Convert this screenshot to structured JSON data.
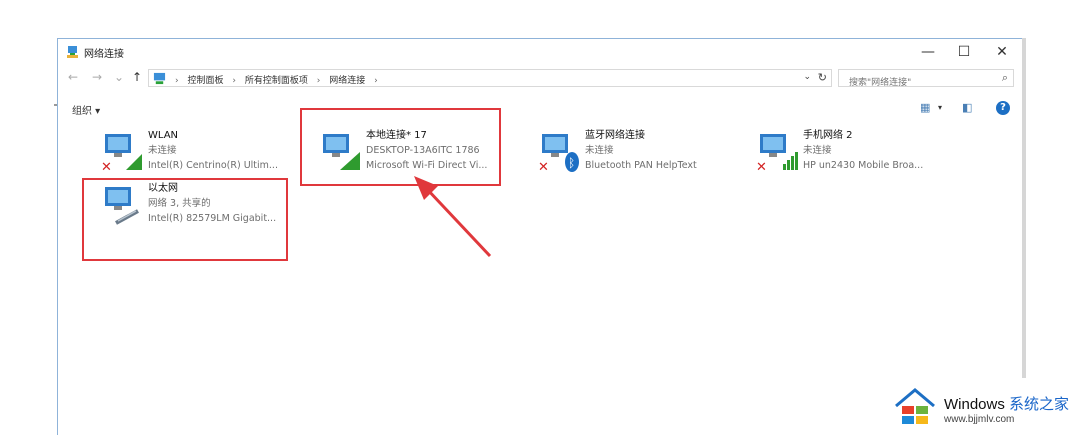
{
  "window": {
    "title": "网络连接",
    "buttons": {
      "minimize": "—",
      "maximize": "☐",
      "close": "✕"
    }
  },
  "nav": {
    "back": "←",
    "forward": "→",
    "recent": "⌄",
    "up": "↑",
    "breadcrumb": [
      "控制面板",
      "所有控制面板项",
      "网络连接"
    ],
    "separator": "›",
    "search_placeholder": "搜索\"网络连接\""
  },
  "commandbar": {
    "organize": "组织 ▾"
  },
  "connections": [
    {
      "name": "WLAN",
      "status": "未连接",
      "adapter": "Intel(R) Centrino(R) Ultim...",
      "icon": "wifi-adapter-icon",
      "state": "disconnected"
    },
    {
      "name": "本地连接* 17",
      "status": "DESKTOP-13A6ITC 1786",
      "adapter": "Microsoft Wi-Fi Direct Vi...",
      "icon": "wifi-adapter-icon",
      "state": "connected"
    },
    {
      "name": "蓝牙网络连接",
      "status": "未连接",
      "adapter": "Bluetooth PAN HelpText",
      "icon": "bluetooth-adapter-icon",
      "state": "disconnected"
    },
    {
      "name": "手机网络 2",
      "status": "未连接",
      "adapter": "HP un2430 Mobile Broa...",
      "icon": "mobile-broadband-icon",
      "state": "disconnected"
    },
    {
      "name": "以太网",
      "status": "网络 3, 共享的",
      "adapter": "Intel(R) 82579LM Gigabit...",
      "icon": "ethernet-adapter-icon",
      "state": "connected"
    }
  ],
  "watermark": {
    "brand": "Windows",
    "brand_cn": "系统之家",
    "url": "www.bjjmlv.com"
  },
  "colors": {
    "highlight": "#e0383c",
    "accent": "#1d6fc4",
    "signal": "#3aa13a",
    "error": "#d32323"
  }
}
